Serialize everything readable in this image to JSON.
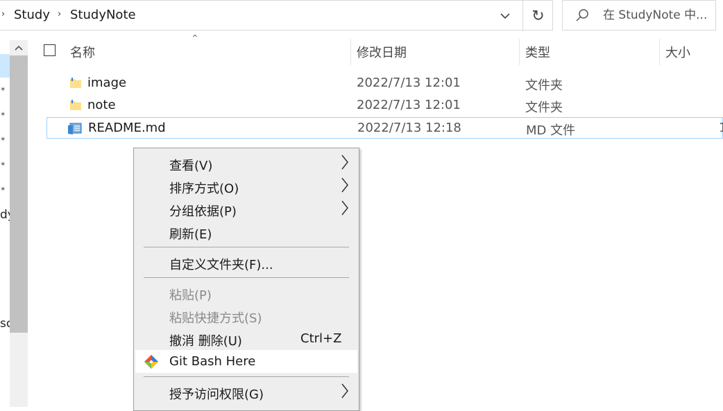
{
  "address": {
    "crumbs": [
      "Study",
      "StudyNote"
    ],
    "dropdown_icon": "chevron-down-icon",
    "refresh_icon": "refresh-icon"
  },
  "search": {
    "placeholder": "在 StudyNote 中..."
  },
  "nav": {
    "fragments": [
      "dy",
      "sc"
    ]
  },
  "columns": {
    "name": "名称",
    "date": "修改日期",
    "type": "类型",
    "size": "大小"
  },
  "files": [
    {
      "name": "image",
      "date": "2022/7/13 12:01",
      "type": "文件夹",
      "icon": "folder-icon"
    },
    {
      "name": "note",
      "date": "2022/7/13 12:01",
      "type": "文件夹",
      "icon": "folder-icon"
    },
    {
      "name": "README.md",
      "date": "2022/7/13 12:18",
      "type": "MD 文件",
      "size": "1",
      "icon": "md-file-icon"
    }
  ],
  "menu": {
    "view": "查看(V)",
    "sort": "排序方式(O)",
    "group": "分组依据(P)",
    "refresh": "刷新(E)",
    "customize": "自定义文件夹(F)...",
    "paste": "粘贴(P)",
    "paste_shortcut": "粘贴快捷方式(S)",
    "undo_delete": "撤消 删除(U)",
    "undo_shortcut": "Ctrl+Z",
    "git_bash": "Git Bash Here",
    "grant_access": "授予访问权限(G)"
  },
  "colors": {
    "selection": "#cce8ff",
    "focus_border": "#99d1ff",
    "menu_bg": "#eeeeee",
    "folder": "#f8d775"
  }
}
